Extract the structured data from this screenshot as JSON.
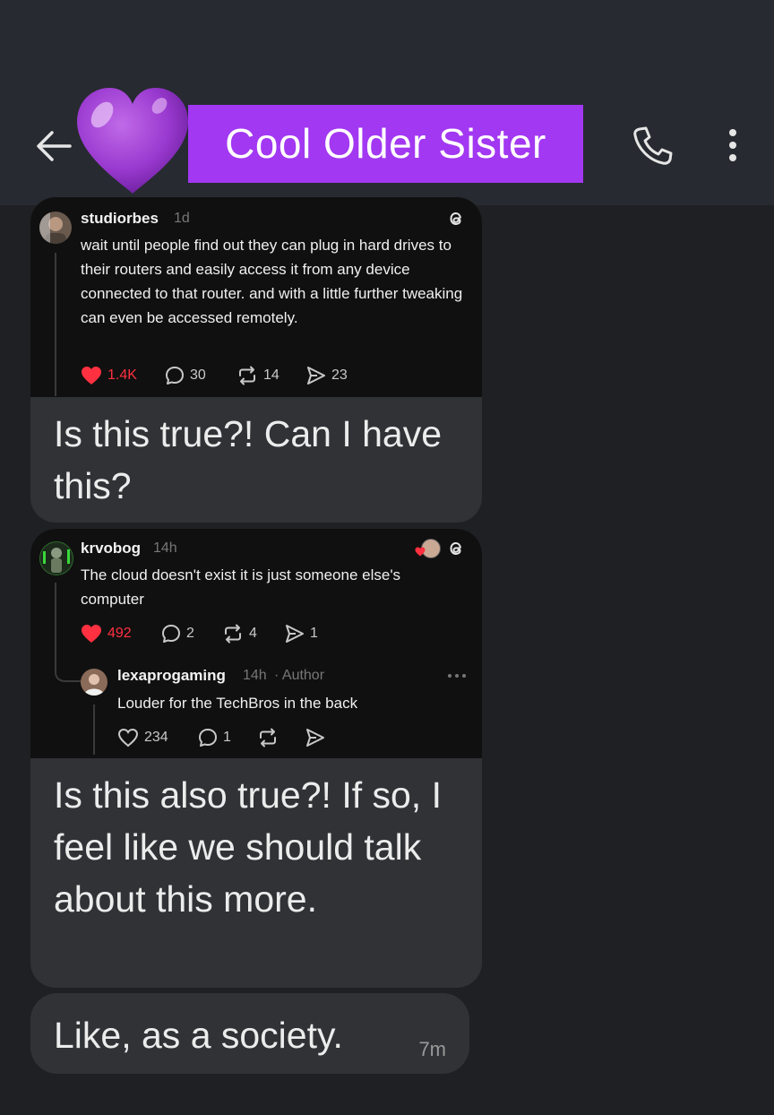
{
  "header": {
    "title": "Cool Older Sister",
    "heart_emoji": "purple-heart",
    "colors": {
      "background": "#272a30",
      "title_highlight": "#a238f2"
    }
  },
  "messages": [
    {
      "shared_post": {
        "username": "studiorbes",
        "age": "1d",
        "text": "wait until people find out they can plug in hard drives to their routers and easily access it from any device connected to that router. and with a little further tweaking can even be accessed remotely.",
        "likes": "1.4K",
        "replies": "30",
        "reposts": "14",
        "shares": "23"
      },
      "text": "Is this true?! Can I have this?"
    },
    {
      "shared_post": {
        "username": "krvobog",
        "age": "14h",
        "text": "The cloud doesn't exist it is just someone else's computer",
        "likes": "492",
        "replies": "2",
        "reposts": "4",
        "shares": "1",
        "reply": {
          "username": "lexaprogaming",
          "age": "14h",
          "tag": "· Author",
          "text": "Louder for the TechBros in the back",
          "likes": "234",
          "replies": "1"
        }
      },
      "text": "Is this also true?! If so, I feel like we should talk about this more."
    },
    {
      "text": "Like, as a society.",
      "time": "7m"
    }
  ],
  "colors": {
    "app_background": "#1e2024",
    "bubble": "#303236",
    "like_red": "#ff3040"
  }
}
